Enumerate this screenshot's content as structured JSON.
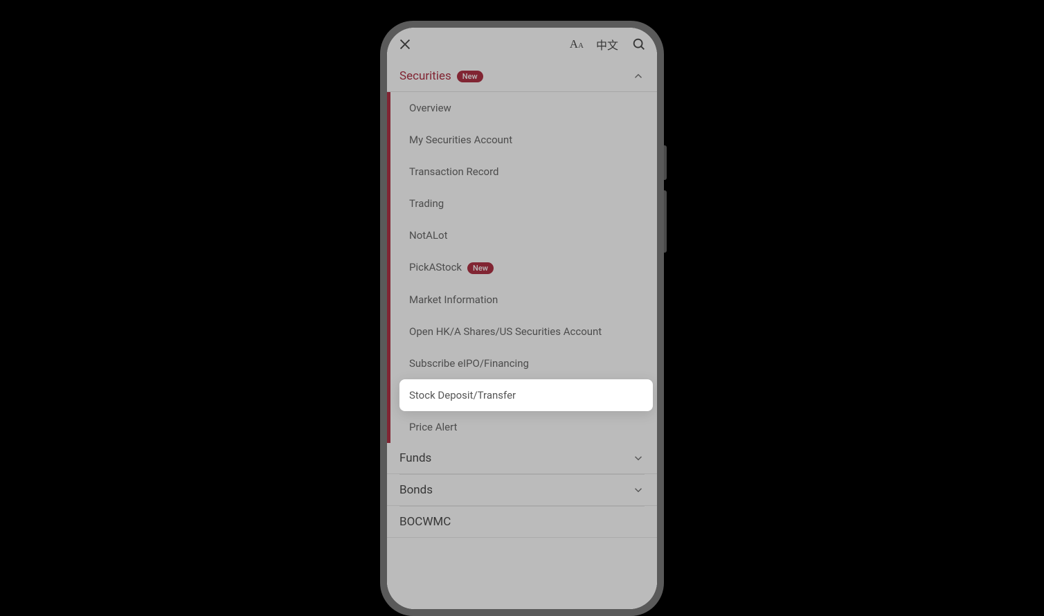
{
  "topbar": {
    "language_label": "中文"
  },
  "sections": {
    "securities": {
      "label": "Securities",
      "badge": "New"
    },
    "funds": {
      "label": "Funds"
    },
    "bonds": {
      "label": "Bonds"
    },
    "bocwmc": {
      "label": "BOCWMC"
    }
  },
  "securities_items": [
    {
      "label": "Overview",
      "badge": null
    },
    {
      "label": "My Securities Account",
      "badge": null
    },
    {
      "label": "Transaction Record",
      "badge": null
    },
    {
      "label": "Trading",
      "badge": null
    },
    {
      "label": "NotALot",
      "badge": null
    },
    {
      "label": "PickAStock",
      "badge": "New"
    },
    {
      "label": "Market Information",
      "badge": null
    },
    {
      "label": "Open HK/A Shares/US Securities Account",
      "badge": null
    },
    {
      "label": "Subscribe eIPO/Financing",
      "badge": null
    },
    {
      "label": "Stock Deposit/Transfer",
      "badge": null
    },
    {
      "label": "Price Alert",
      "badge": null
    }
  ],
  "highlight_index": 9,
  "colors": {
    "accent": "#a6192e"
  }
}
